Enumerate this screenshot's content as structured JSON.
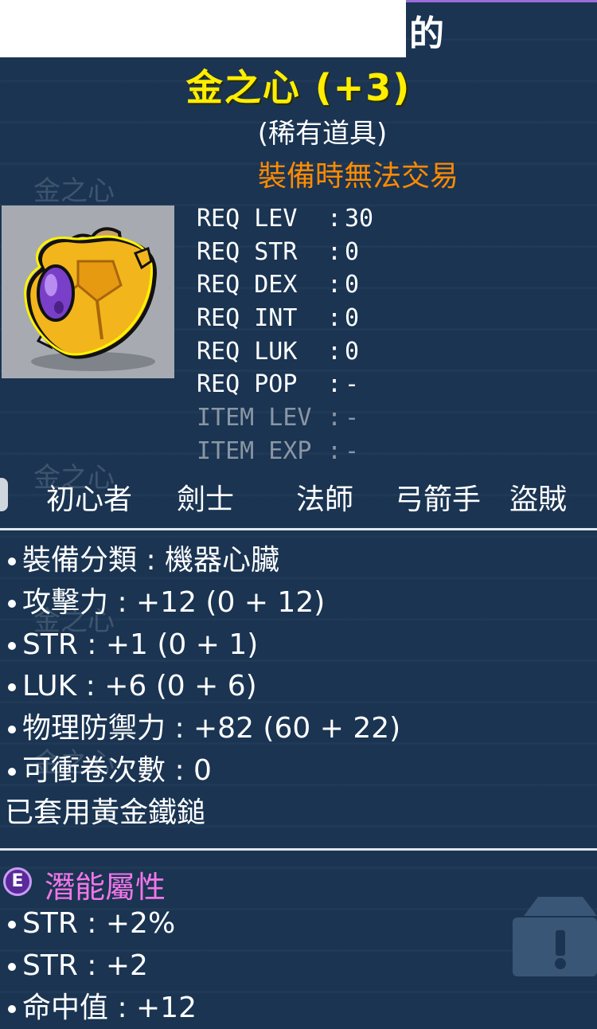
{
  "header": {
    "owner_suffix": "的",
    "item_name": "金之心 (+3)",
    "rarity": "(稀有道具)",
    "trade_notice": "裝備時無法交易",
    "watermark": "金之心"
  },
  "requirements": [
    {
      "label": "REQ LEV",
      "value": "30",
      "dim": false
    },
    {
      "label": "REQ STR",
      "value": "0",
      "dim": false
    },
    {
      "label": "REQ DEX",
      "value": "0",
      "dim": false
    },
    {
      "label": "REQ INT",
      "value": "0",
      "dim": false
    },
    {
      "label": "REQ LUK",
      "value": "0",
      "dim": false
    },
    {
      "label": "REQ POP",
      "value": "-",
      "dim": false
    },
    {
      "label": "ITEM LEV",
      "value": "-",
      "dim": true
    },
    {
      "label": "ITEM EXP",
      "value": "-",
      "dim": true
    }
  ],
  "jobs": [
    "初心者",
    "劍士",
    "法師",
    "弓箭手",
    "盜賊"
  ],
  "stats": [
    "裝備分類 : 機器心臟",
    "攻擊力 : +12 (0 + 12)",
    "STR : +1 (0 + 1)",
    "LUK : +6 (0 + 6)",
    "物理防禦力 : +82 (60 + 22)",
    "可衝卷次數 : 0"
  ],
  "set_text": "已套用黃金鐵鎚",
  "potential": {
    "badge": "E",
    "title": "潛能屬性",
    "lines": [
      "STR : +2%",
      "STR : +2",
      "命中值 : +12"
    ]
  },
  "colors": {
    "background": "#1a3452",
    "item_name": "#ffee00",
    "trade_notice": "#ff8a00",
    "potential_title": "#f176e8",
    "dim_text": "#8a96a4"
  }
}
